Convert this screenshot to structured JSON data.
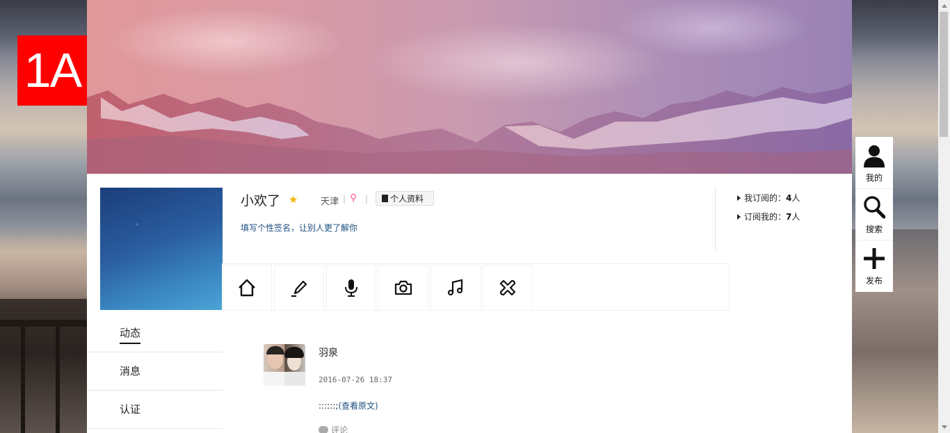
{
  "logo": {
    "text": "1A",
    "color": "#ff0000"
  },
  "profile": {
    "name": "小欢了",
    "city": "天津",
    "separator": "|",
    "profile_button": "个人资料",
    "signature": "填写个性签名，让别人更了解你"
  },
  "stats": {
    "subscribed_label": "我订阅的：",
    "subscribed_count": "4",
    "subscribed_unit": "人",
    "subscribers_label": "订阅我的：",
    "subscribers_count": "7",
    "subscribers_unit": "人"
  },
  "toolbar": {
    "tools": [
      "home-icon",
      "pencil-icon",
      "microphone-icon",
      "camera-icon",
      "music-icon",
      "airplane-icon"
    ]
  },
  "sidenav": {
    "items": [
      {
        "label": "动态",
        "active": true
      },
      {
        "label": "消息",
        "active": false
      },
      {
        "label": "认证",
        "active": false
      }
    ]
  },
  "post": {
    "author": "羽泉",
    "time": "2016-07-26 18:37",
    "content": "::::::;",
    "view_original": "(查看原文)",
    "comment_label": "评论"
  },
  "floatbar": {
    "items": [
      {
        "label": "我的",
        "icon": "user-icon"
      },
      {
        "label": "搜索",
        "icon": "search-icon"
      },
      {
        "label": "发布",
        "icon": "plus-icon"
      }
    ]
  }
}
